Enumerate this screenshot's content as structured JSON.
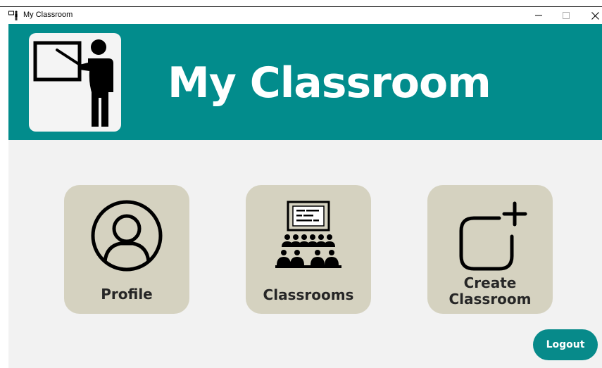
{
  "window": {
    "title": "My Classroom",
    "controls": {
      "minimize": "–",
      "maximize": "☐",
      "close": "✕"
    }
  },
  "header": {
    "title": "My Classroom",
    "background": "#028c8c",
    "logo_icon": "teacher-at-board-icon"
  },
  "cards": [
    {
      "label": "Profile",
      "icon": "user-circle-icon"
    },
    {
      "label": "Classrooms",
      "icon": "classroom-audience-icon"
    },
    {
      "label_line1": "Create",
      "label_line2": "Classroom",
      "icon": "add-square-icon"
    }
  ],
  "card_color": "#d5d2c0",
  "logout_label": "Logout"
}
